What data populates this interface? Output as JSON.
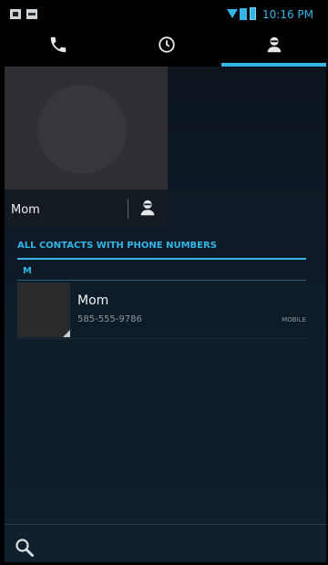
{
  "status": {
    "time": "10:16 PM"
  },
  "tabs": [
    {
      "name": "phone",
      "icon": "phone-icon"
    },
    {
      "name": "recent",
      "icon": "clock-icon"
    },
    {
      "name": "contacts",
      "icon": "contact-icon",
      "selected": true
    }
  ],
  "favorite": {
    "name": "Mom"
  },
  "list": {
    "section_title": "ALL CONTACTS WITH PHONE NUMBERS",
    "letter": "M",
    "contacts": [
      {
        "name": "Mom",
        "number": "585-555-9786",
        "type": "MOBILE"
      }
    ]
  },
  "colors": {
    "accent": "#33b5e5",
    "background": "#0e1a26"
  }
}
